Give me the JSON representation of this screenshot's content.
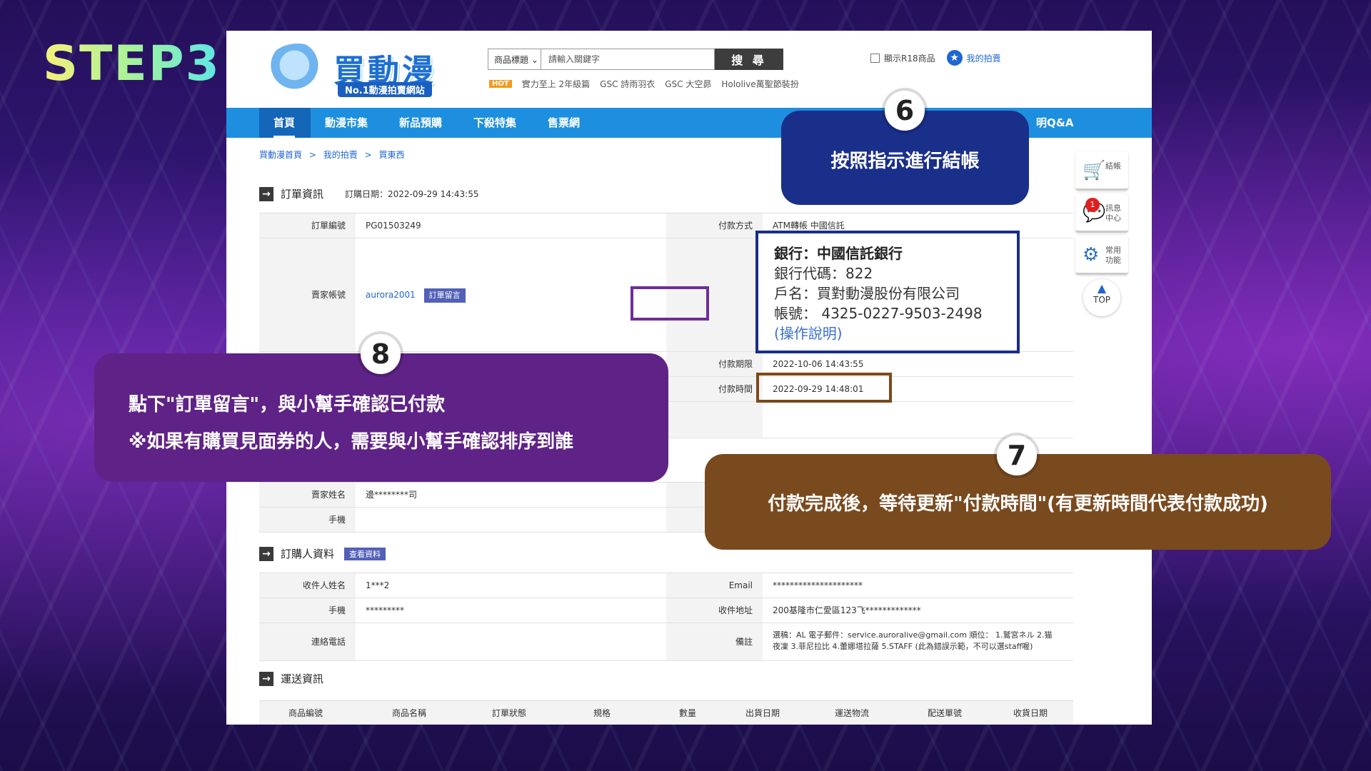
{
  "step_title": "STEP3",
  "header": {
    "logo_text": "買動漫",
    "logo_sub": "No.1動漫拍賣網站",
    "search_category": "商品標題",
    "search_placeholder": "請輸入關鍵字",
    "search_button": "搜 尋",
    "hot_label": "HOT",
    "hot_items": [
      "實力至上 2年級篇",
      "GSC 詩雨羽衣",
      "GSC 大空昴",
      "Hololive萬聖節裝扮"
    ],
    "r18_label": "顯示R18商品",
    "my_bid": "我的拍賣"
  },
  "nav": {
    "items": [
      "首頁",
      "動漫市集",
      "新品預購",
      "下殺特集",
      "售票網"
    ],
    "right_item": "明Q&A"
  },
  "breadcrumb": [
    "買動漫首頁",
    ">",
    "我的拍賣",
    ">",
    "買東西"
  ],
  "order_section": {
    "title": "訂單資訊",
    "order_date": "訂購日期：2022-09-29 14:43:55",
    "order_no_label": "訂單編號",
    "order_no": "PG01503249",
    "pay_method_label": "付款方式",
    "pay_method": "ATM轉帳 中國信託",
    "seller_label": "賣家帳號",
    "seller_account": "aurora2001",
    "message_button": "訂單留言",
    "pay_deadline_label": "付款期限",
    "pay_deadline": "2022-10-06 14:43:55",
    "pay_time_label": "付款時間",
    "pay_time": "2022-09-29 14:48:01"
  },
  "bank_info": {
    "bank": "銀行：中國信託銀行",
    "code": "銀行代碼：822",
    "name": "戶名：買對動漫股份有限公司",
    "account": "帳號： 4325-0227-9503-2498",
    "help": "(操作說明)"
  },
  "seller_rows": {
    "seller_name_label": "賣家姓名",
    "seller_name": "邊********司",
    "phone_label": "手機"
  },
  "buyer_section": {
    "title": "訂購人資料",
    "view_button": "查看資料",
    "recipient_label": "收件人姓名",
    "recipient": "1***2",
    "email_label": "Email",
    "email": "*********************",
    "phone_label": "手機",
    "phone": "*********",
    "address_label": "收件地址",
    "address": "200基隆市仁愛區123飞*************",
    "tel_label": "連絡電話",
    "note_label": "備註",
    "note_line1": "選稿：AL 電子郵件：service.auroralive@gmail.com 順位： 1.鷲宮ネル 2.猫",
    "note_line2": "夜凜 3.菲尼拉比 4.蕾娜塔拉薩 5.STAFF (此為錯誤示範，不可以選staff喔)"
  },
  "shipping_section": {
    "title": "運送資訊",
    "columns": [
      "商品編號",
      "商品名稱",
      "訂單狀態",
      "規格",
      "數量",
      "出貨日期",
      "運送物流",
      "配送單號",
      "收貨日期"
    ]
  },
  "sidebar": {
    "checkout": "結帳",
    "message_center": "訊息中心",
    "badge_count": "1",
    "common_functions": "常用功能",
    "top": "TOP"
  },
  "callouts": {
    "n6": "6",
    "c6_text": "按照指示進行結帳",
    "n7": "7",
    "c7_text": "付款完成後，等待更新\"付款時間\"(有更新時間代表付款成功)",
    "n8": "8",
    "c8_line1": "點下\"訂單留言\"，與小幫手確認已付款",
    "c8_line2": "※如果有購買見面券的人，需要與小幫手確認排序到誰"
  }
}
